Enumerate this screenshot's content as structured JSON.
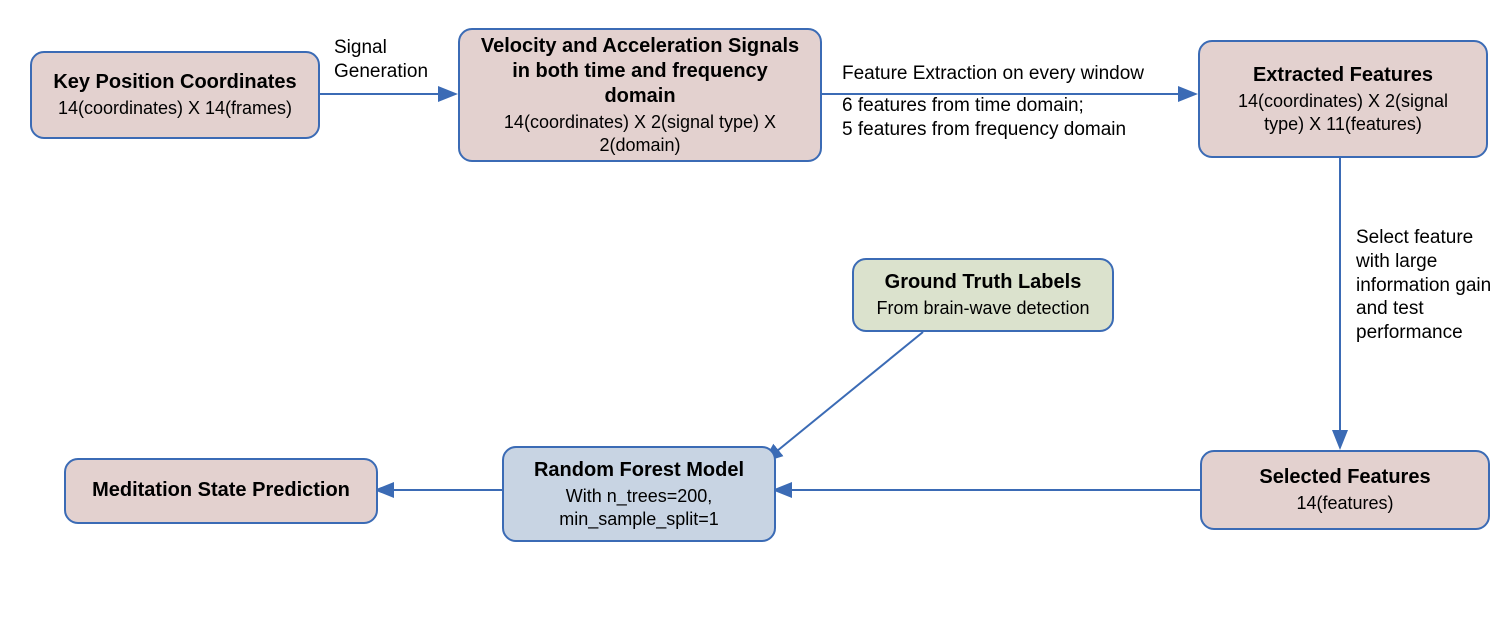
{
  "nodes": {
    "keypos": {
      "title": "Key Position Coordinates",
      "sub": "14(coordinates) X 14(frames)"
    },
    "signals": {
      "title": "Velocity and Acceleration Signals in both time and frequency domain",
      "sub": "14(coordinates) X 2(signal type) X 2(domain)"
    },
    "extracted": {
      "title": "Extracted Features",
      "sub": "14(coordinates) X 2(signal type) X 11(features)"
    },
    "ground": {
      "title": "Ground Truth Labels",
      "sub": "From brain-wave detection"
    },
    "selected": {
      "title": "Selected Features",
      "sub": "14(features)"
    },
    "rf": {
      "title": "Random Forest Model",
      "sub": "With n_trees=200, min_sample_split=1"
    },
    "pred": {
      "title": "Meditation State Prediction",
      "sub": ""
    }
  },
  "edges": {
    "keypos_to_signals": "Signal Generation",
    "signals_to_extracted_line1": "Feature Extraction on every window",
    "signals_to_extracted_line2": "6 features from time domain;",
    "signals_to_extracted_line3": "5 features from frequency domain",
    "extracted_to_selected_line1": "Select feature",
    "extracted_to_selected_line2": "with large",
    "extracted_to_selected_line3": "information gain",
    "extracted_to_selected_line4": "and test",
    "extracted_to_selected_line5": "performance"
  }
}
